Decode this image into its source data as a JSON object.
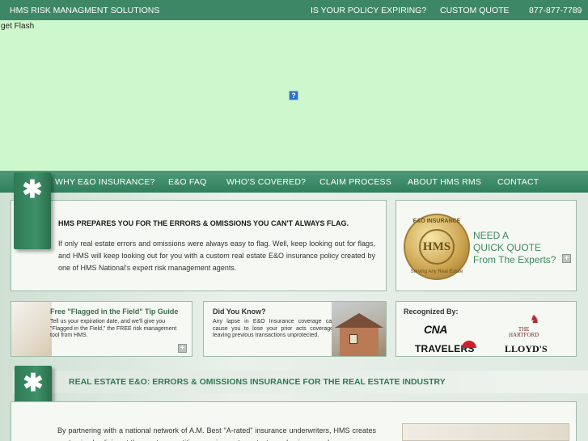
{
  "topbar": {
    "brand": "HMS RISK MANAGMENT SOLUTIONS",
    "policy_link": "IS YOUR POLICY EXPIRING?",
    "quote_link": "CUSTOM QUOTE",
    "phone": "877-877-7789"
  },
  "flash": {
    "placeholder_text": "get Flash",
    "plugin_icon": "?"
  },
  "nav": {
    "items": [
      "WHY E&O INSURANCE?",
      "E&O FAQ",
      "WHO'S COVERED?",
      "CLAIM PROCESS",
      "ABOUT HMS RMS",
      "CONTACT"
    ]
  },
  "intro": {
    "title": "HMS PREPARES YOU FOR THE ERRORS & OMISSIONS YOU CAN'T ALWAYS FLAG.",
    "body": "If only real estate errors and omissions were always easy to flag. Well, keep looking out for flags, and HMS will keep looking out for you with a custom real estate E&O insurance policy created by one of HMS National's expert risk management agents."
  },
  "quick_quote": {
    "line1": "NEED A",
    "line2": "QUICK QUOTE",
    "line3": "From The Experts?",
    "seal_text": "HMS",
    "seal_top": "E&O INSURANCE",
    "seal_bottom": "Serving Any Real Estate"
  },
  "tip": {
    "title": "Free \"Flagged in the Field\" Tip Guide",
    "body": "Tell us your expiration date, and we'll give you \"Flagged in the Field,\" the FREE risk management tool from HMS."
  },
  "did_you_know": {
    "title": "Did You Know?",
    "body": "Any lapse in E&O Insurance coverage can cause you to lose your prior acts coverage, leaving previous transactions unprotected."
  },
  "recognized": {
    "title": "Recognized By:",
    "logos": {
      "cna": "CNA",
      "hartford_1": "THE",
      "hartford_2": "HARTFORD",
      "travelers": "TRAVELERS",
      "lloyds": "LLOYD'S"
    }
  },
  "section": {
    "title": "REAL ESTATE E&O: ERRORS & OMISSIONS INSURANCE FOR THE REAL ESTATE INDUSTRY",
    "body": "By partnering with a national network of A.M. Best \"A-rated\" insurance underwriters, HMS creates customized policies at the most competitive premiums - to protect your business and"
  },
  "icons": {
    "flag": "asterisk-flag-icon",
    "plus": "plus-icon",
    "stag": "stag-icon",
    "umbrella": "umbrella-icon"
  },
  "colors": {
    "brand_green": "#3e8766",
    "flash_bg": "#cdf7cd",
    "accent_green": "#2f7a52"
  }
}
